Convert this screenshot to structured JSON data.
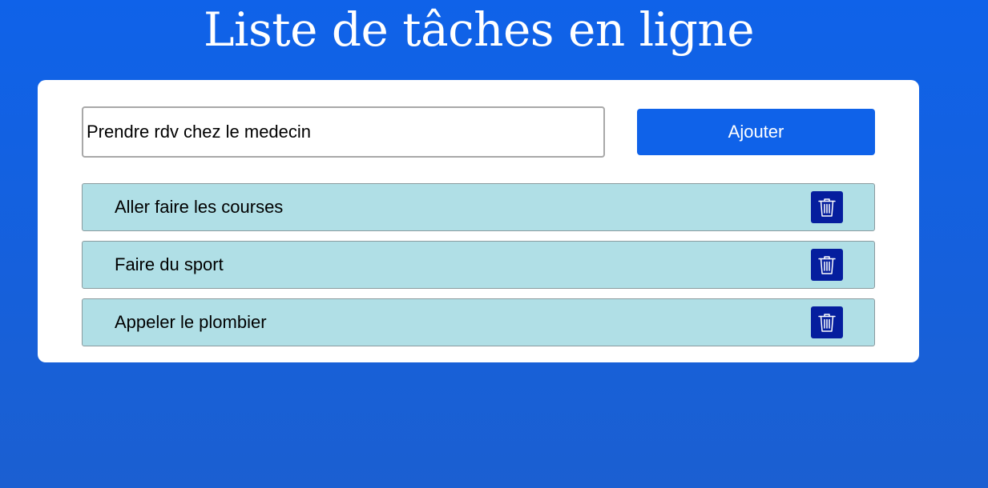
{
  "header": {
    "title": "Liste de tâches en ligne"
  },
  "form": {
    "input_value": "Prendre rdv chez le medecin",
    "add_label": "Ajouter"
  },
  "tasks": [
    {
      "label": "Aller faire les courses",
      "delete_icon": "trash-icon"
    },
    {
      "label": "Faire du sport",
      "delete_icon": "trash-icon"
    },
    {
      "label": "Appeler le plombier",
      "delete_icon": "trash-icon"
    }
  ],
  "colors": {
    "background": "#0f62e9",
    "card": "#ffffff",
    "accent": "#0f62e9",
    "task_background": "#b0dfe6",
    "delete_button": "#051e9e"
  }
}
